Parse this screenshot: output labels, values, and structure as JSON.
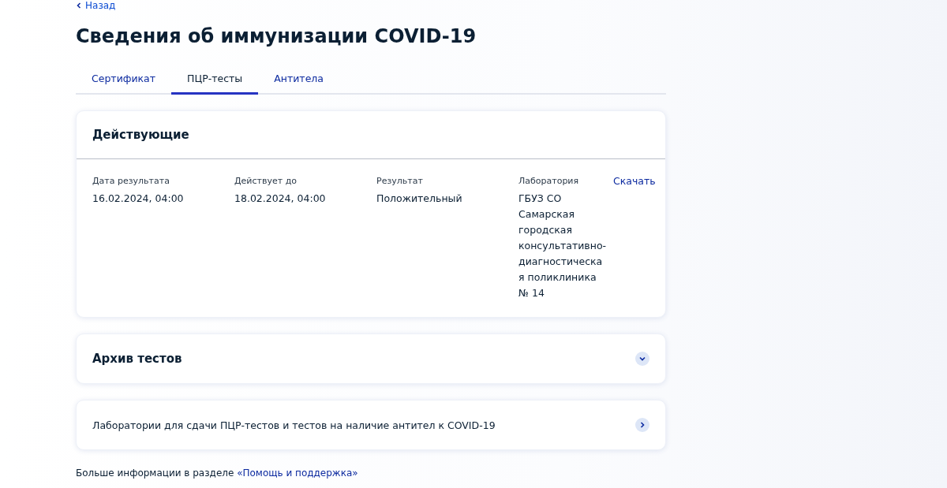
{
  "back_link": "Назад",
  "title": "Сведения об иммунизации COVID-19",
  "tabs": [
    {
      "label": "Сертификат",
      "selected": false
    },
    {
      "label": "ПЦР-тесты",
      "selected": true
    },
    {
      "label": "Антитела",
      "selected": false
    }
  ],
  "active_tests": {
    "title": "Действующие",
    "download": "Скачать",
    "fields": [
      {
        "label": "Дата результата",
        "value": "16.02.2024, 04:00"
      },
      {
        "label": "Действует до",
        "value": "18.02.2024, 04:00"
      },
      {
        "label": "Результат",
        "value": "Положительный"
      },
      {
        "label": "Лаборатория",
        "value": "ГБУЗ СО Самарская городская консультативно-диагностическая поликлиника № 14"
      }
    ]
  },
  "archive": {
    "title": "Архив тестов",
    "expanded": false
  },
  "labs_link": {
    "text": "Лаборатории для сдачи ПЦР-тестов и тестов на наличие антител к COVID-19"
  },
  "footer": {
    "text": "Больше информации в разделе",
    "link": "«Помощь и поддержка»"
  }
}
